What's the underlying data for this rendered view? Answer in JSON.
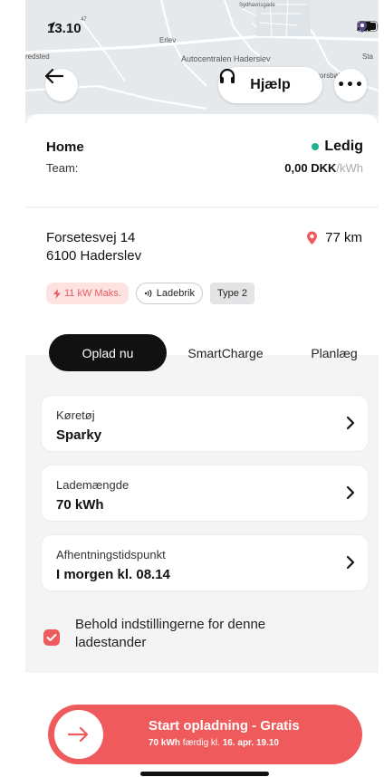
{
  "status_bar": {
    "time": "13.10",
    "small_number": "47"
  },
  "map": {
    "labels": [
      "Erlev",
      "Autocentralen Haderslev",
      "Brorsbøl",
      "redsted",
      "Sta",
      "Sydhavnsgade"
    ]
  },
  "header": {
    "help_label": "Hjælp",
    "more_label": "•••"
  },
  "station": {
    "name": "Home",
    "team_label": "Team:",
    "status": "Ledig",
    "status_color": "#1fb08f",
    "price": "0,00 DKK",
    "price_unit": "/kWh"
  },
  "address": {
    "line1": "Forsetesvej 14",
    "line2": "6100 Haderslev",
    "distance": "77 km"
  },
  "chips": {
    "power": "11 kW Maks.",
    "cable": "Ladebrik",
    "type": "Type 2"
  },
  "tabs": [
    {
      "label": "Oplad nu"
    },
    {
      "label": "SmartCharge"
    },
    {
      "label": "Planlæg"
    }
  ],
  "rows": [
    {
      "label": "Køretøj",
      "value": "Sparky"
    },
    {
      "label": "Lademængde",
      "value": "70 kWh"
    },
    {
      "label": "Afhentningstidspunkt",
      "value": "I morgen kl. 08.14"
    }
  ],
  "keep_settings": {
    "label": "Behold indstillingerne for denne ladestander",
    "checked": true
  },
  "start": {
    "title": "Start opladning - Gratis",
    "sub_amount": "70 kWh",
    "sub_mid": " færdig kl. ",
    "sub_time": "16. apr. 19.10"
  },
  "colors": {
    "accent": "#ef5b5c",
    "status_green": "#1fb08f"
  }
}
